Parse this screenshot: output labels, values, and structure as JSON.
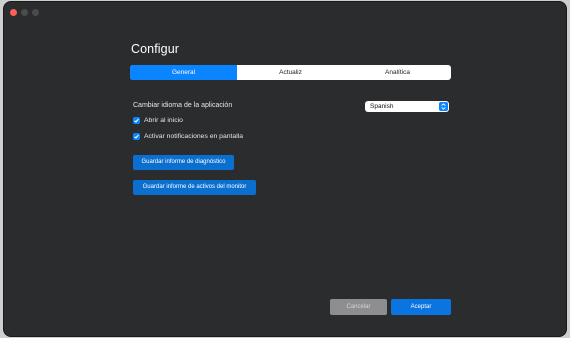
{
  "window": {
    "title": "Configur"
  },
  "tabs": [
    {
      "label": "General",
      "active": true
    },
    {
      "label": "Actualiz",
      "active": false
    },
    {
      "label": "Analítica",
      "active": false
    }
  ],
  "language": {
    "label": "Cambiar idioma de la aplicación",
    "selected": "Spanish"
  },
  "options": [
    {
      "label": "Abrir al inicio",
      "checked": true
    },
    {
      "label": "Activar notificaciones en pantalla",
      "checked": true
    }
  ],
  "actions": {
    "diagnostic_label": "Guardar informe de diagnóstico",
    "assets_label": "Guardar informe de activos del monitor"
  },
  "footer": {
    "cancel_label": "Cancelar",
    "accept_label": "Aceptar"
  },
  "colors": {
    "accent": "#0a84ff",
    "window_bg": "#2b2c2e",
    "close": "#ff5f57"
  }
}
